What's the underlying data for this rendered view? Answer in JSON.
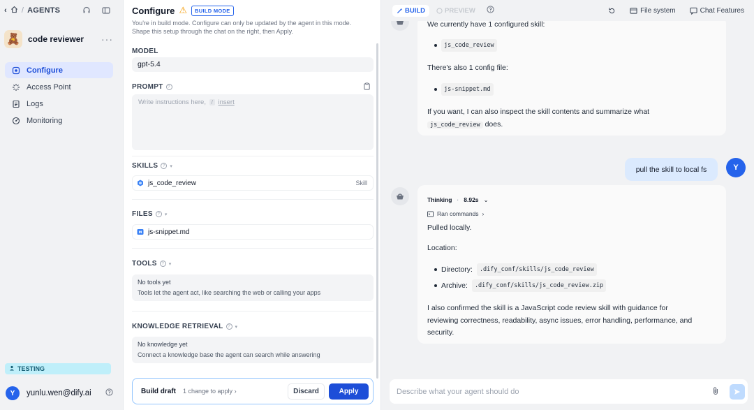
{
  "breadcrumb": {
    "section": "AGENTS"
  },
  "agent": {
    "name": "code reviewer"
  },
  "nav": {
    "items": [
      {
        "label": "Configure",
        "icon": "configure-icon",
        "active": true
      },
      {
        "label": "Access Point",
        "icon": "access-point-icon",
        "active": false
      },
      {
        "label": "Logs",
        "icon": "logs-icon",
        "active": false
      },
      {
        "label": "Monitoring",
        "icon": "monitoring-icon",
        "active": false
      }
    ]
  },
  "env_badge": "TESTING",
  "user": {
    "initial": "Y",
    "email": "yunlu.wen@dify.ai"
  },
  "configure": {
    "title": "Configure",
    "mode_badge": "BUILD MODE",
    "description": "You're in build mode. Configure can only be updated by the agent in this mode. Shape this setup through the chat on the right, then Apply.",
    "model": {
      "label": "MODEL",
      "value": "gpt-5.4"
    },
    "prompt": {
      "label": "PROMPT",
      "placeholder_pre": "Write instructions here,",
      "placeholder_key": "/",
      "placeholder_post": "insert"
    },
    "skills": {
      "label": "SKILLS",
      "items": [
        {
          "name": "js_code_review",
          "tag": "Skill"
        }
      ]
    },
    "files": {
      "label": "FILES",
      "items": [
        {
          "name": "js-snippet.md"
        }
      ]
    },
    "tools": {
      "label": "TOOLS",
      "empty_title": "No tools yet",
      "empty_desc": "Tools let the agent act, like searching the web or calling your apps"
    },
    "knowledge": {
      "label": "KNOWLEDGE RETRIEVAL",
      "empty_title": "No knowledge yet",
      "empty_desc": "Connect a knowledge base the agent can search while answering"
    },
    "draft": {
      "label": "Build draft",
      "changes": "1 change to apply",
      "discard": "Discard",
      "apply": "Apply"
    }
  },
  "chat": {
    "tabs": {
      "build": "BUILD",
      "preview": "PREVIEW"
    },
    "toolbar": {
      "file_system": "File system",
      "chat_features": "Chat Features"
    },
    "messages": [
      {
        "role": "assistant",
        "intro": "We currently have 1 configured skill:",
        "skill": "js_code_review",
        "config_intro": "There's also 1 config file:",
        "config_file": "js-snippet.md",
        "offer_pre": "If you want, I can also inspect the skill contents and summarize what",
        "offer_code": "js_code_review",
        "offer_post": "does."
      },
      {
        "role": "user",
        "text": "pull the skill to local fs",
        "initial": "Y"
      },
      {
        "role": "assistant",
        "thinking_label": "Thinking",
        "thinking_time": "8.92s",
        "ran_commands": "Ran commands",
        "result": "Pulled locally.",
        "location_label": "Location:",
        "directory_label": "Directory:",
        "directory_path": ".dify_conf/skills/js_code_review",
        "archive_label": "Archive:",
        "archive_path": ".dify_conf/skills/js_code_review.zip",
        "summary_line1": "I also confirmed the skill is a JavaScript code review skill with guidance for",
        "summary_line2": "reviewing correctness, readability, async issues, error handling, performance, and",
        "summary_line3": "security."
      }
    ],
    "input_placeholder": "Describe what your agent should do"
  }
}
